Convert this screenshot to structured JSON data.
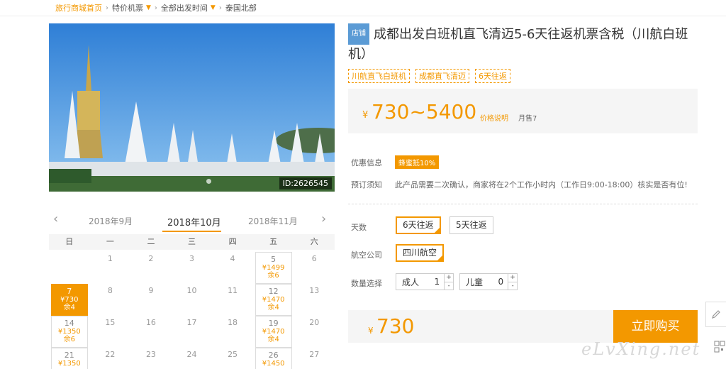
{
  "breadcrumb": {
    "home": "旅行商城首页",
    "items": [
      "特价机票",
      "全部出发时间",
      "泰国北部"
    ]
  },
  "hero": {
    "id_tag": "ID:2626545"
  },
  "calendar": {
    "prev_month": "2018年9月",
    "current_month": "2018年10月",
    "next_month": "2018年11月",
    "weekdays": [
      "日",
      "一",
      "二",
      "三",
      "四",
      "五",
      "六"
    ],
    "rows": [
      [
        {
          "d": ""
        },
        {
          "d": "1"
        },
        {
          "d": "2"
        },
        {
          "d": "3"
        },
        {
          "d": "4"
        },
        {
          "d": "5",
          "p": "¥1499",
          "r": "余6"
        },
        {
          "d": "6"
        }
      ],
      [
        {
          "d": "7",
          "p": "¥730",
          "r": "余4",
          "sel": true
        },
        {
          "d": "8"
        },
        {
          "d": "9"
        },
        {
          "d": "10"
        },
        {
          "d": "11"
        },
        {
          "d": "12",
          "p": "¥1470",
          "r": "余4"
        },
        {
          "d": "13"
        }
      ],
      [
        {
          "d": "14",
          "p": "¥1350",
          "r": "余6"
        },
        {
          "d": "15"
        },
        {
          "d": "16"
        },
        {
          "d": "17"
        },
        {
          "d": "18"
        },
        {
          "d": "19",
          "p": "¥1470",
          "r": "余4"
        },
        {
          "d": "20"
        }
      ],
      [
        {
          "d": "21",
          "p": "¥1350"
        },
        {
          "d": "22"
        },
        {
          "d": "23"
        },
        {
          "d": "24"
        },
        {
          "d": "25"
        },
        {
          "d": "26",
          "p": "¥1450"
        },
        {
          "d": "27"
        }
      ]
    ]
  },
  "product": {
    "shop_tag": "店铺",
    "title": "成都出发白班机直飞清迈5-6天往返机票含税（川航白班机）",
    "tags": [
      "川航直飞白班机",
      "成都直飞清迈",
      "6天往返"
    ],
    "price_currency": "¥",
    "price_range": "730~5400",
    "price_explain": "价格说明",
    "monthly_sold": "月售7"
  },
  "info": {
    "discount_label": "优惠信息",
    "discount_value": "蜂蜜抵10%",
    "booking_label": "预订须知",
    "booking_text": "此产品需要二次确认，商家将在2个工作小时内（工作日9:00-18:00）核实是否有位!"
  },
  "options": {
    "days_label": "天数",
    "days": [
      "6天往返",
      "5天往返"
    ],
    "airline_label": "航空公司",
    "airline": "四川航空",
    "qty_label": "数量选择",
    "adult_label": "成人",
    "adult_qty": "1",
    "child_label": "儿童",
    "child_qty": "0",
    "plus": "+",
    "minus": "-"
  },
  "checkout": {
    "currency": "¥",
    "total": "730",
    "buy_label": "立即购买"
  },
  "watermark": "eLvXing.net",
  "colors": {
    "accent": "#f39800",
    "shop_tag": "#5b9bd5"
  }
}
